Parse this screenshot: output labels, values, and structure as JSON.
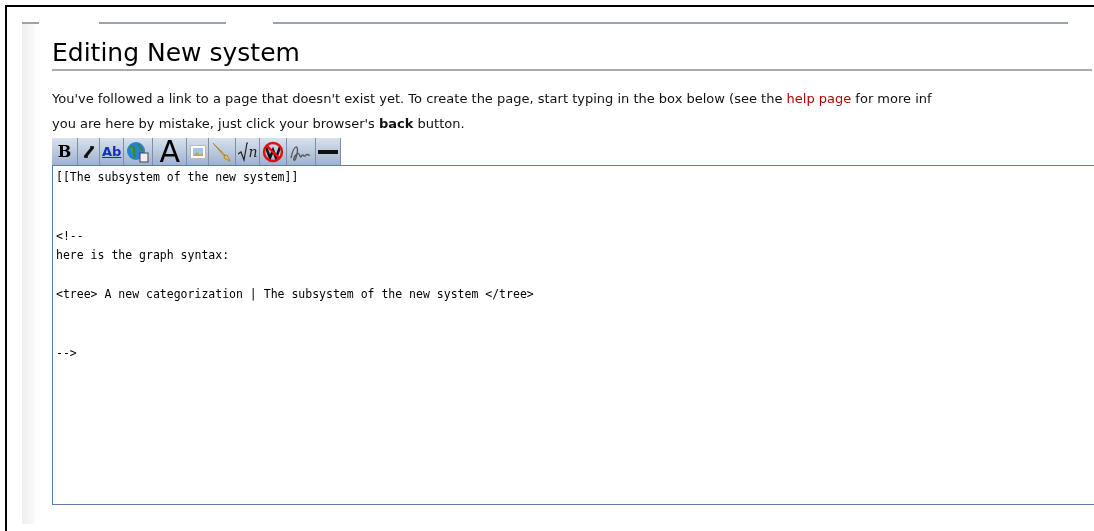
{
  "page": {
    "title": "Editing New system",
    "intro_line_1": {
      "before": "You've followed a link to a page that doesn't exist yet. To create the page, start typing in the box below (see the ",
      "link": "help page",
      "after": " for more inf"
    },
    "intro_line_2": "you are here by mistake, just click your browser's **back** button."
  },
  "toolbar": [
    {
      "kind": "bold",
      "label": "B"
    },
    {
      "kind": "italic"
    },
    {
      "kind": "link",
      "label": "Ab"
    },
    {
      "kind": "globe"
    },
    {
      "kind": "headline",
      "label": "A"
    },
    {
      "kind": "image"
    },
    {
      "kind": "media"
    },
    {
      "kind": "math",
      "label": "n"
    },
    {
      "kind": "nowiki"
    },
    {
      "kind": "signature"
    },
    {
      "kind": "rule"
    }
  ],
  "editor": {
    "value": "[[The subsystem of the new system]]\n\n\n<!--\nhere is the graph syntax:\n\n<tree> A new categorization | The subsystem of the new system </tree>\n\n\n-->"
  }
}
